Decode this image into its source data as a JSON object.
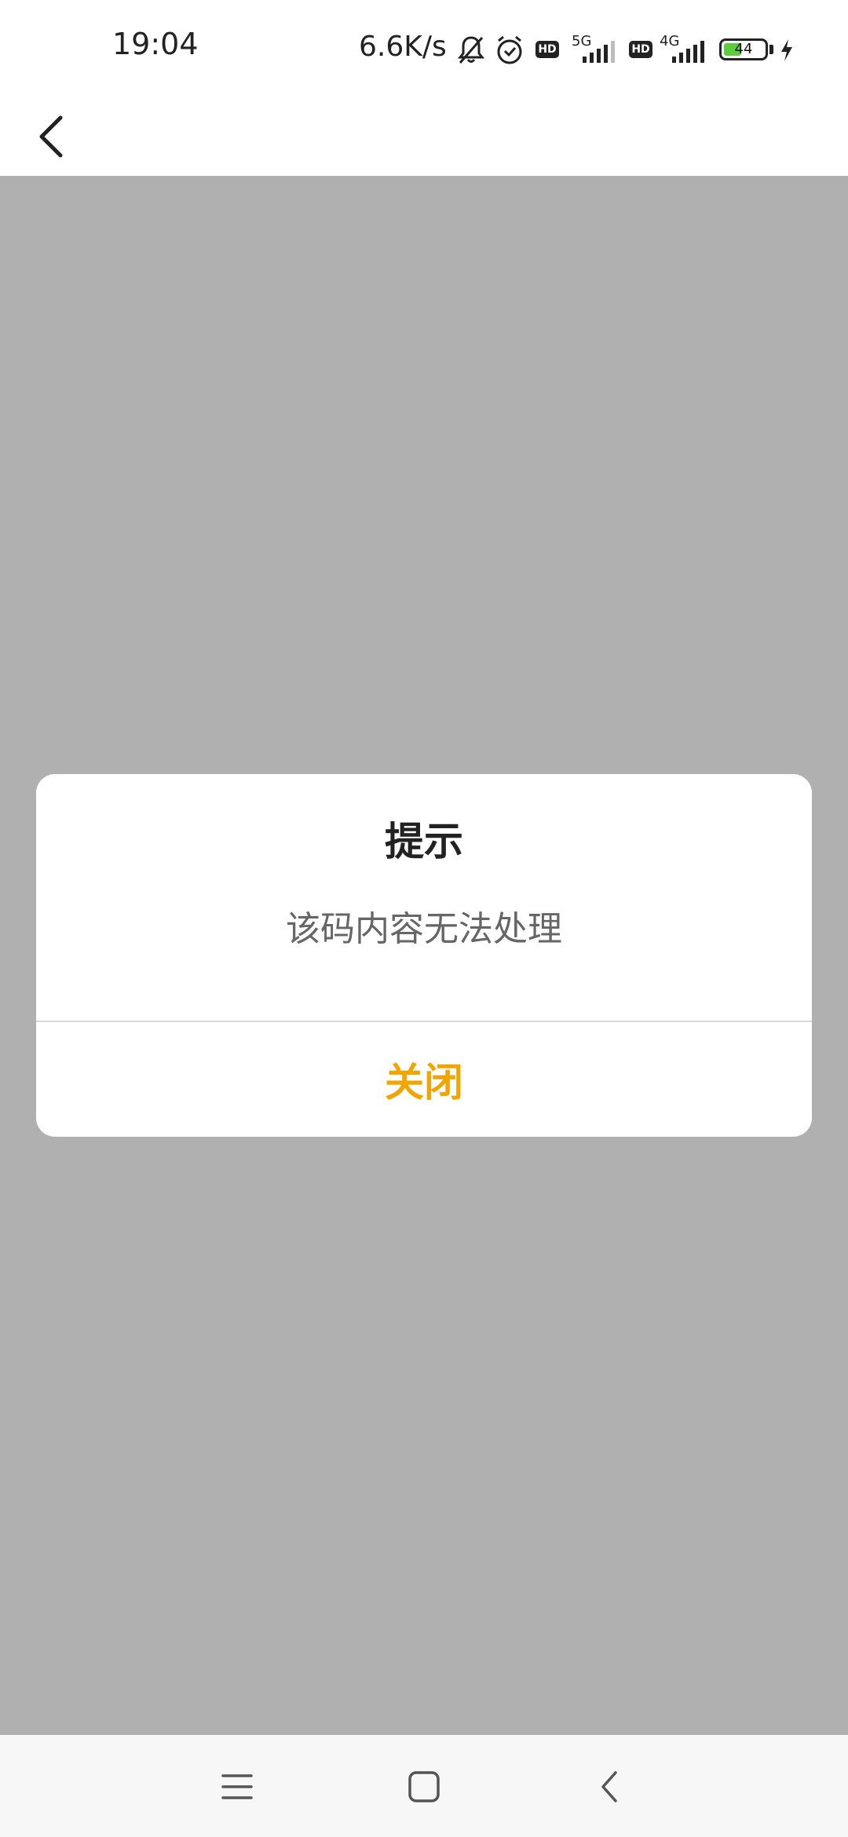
{
  "status_bar": {
    "time": "19:04",
    "net_speed": "6.6K/s",
    "hd1": "HD",
    "net1": "5G",
    "hd2": "HD",
    "net2": "4G",
    "battery_level": "44",
    "battery_fill_color": "#5ccd3e",
    "icons": [
      "bell-off-icon",
      "alarm-icon",
      "hd-icon",
      "signal-5g-icon",
      "hd-icon",
      "signal-4g-icon",
      "battery-icon",
      "charging-icon"
    ]
  },
  "header": {
    "back_icon": "chevron-left-icon"
  },
  "dialog": {
    "title": "提示",
    "message": "该码内容无法处理",
    "button_label": "关闭",
    "button_color": "#f2a500"
  },
  "nav_bar": {
    "icons": [
      "menu-icon",
      "home-icon",
      "back-icon"
    ]
  }
}
